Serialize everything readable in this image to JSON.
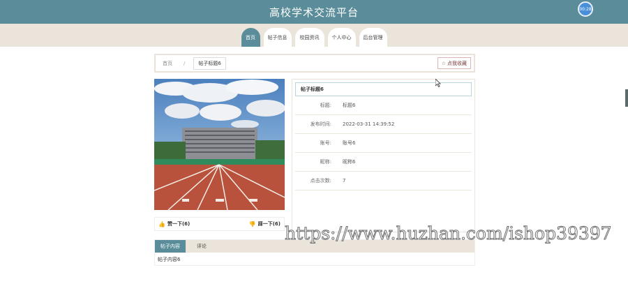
{
  "header": {
    "title": "高校学术交流平台",
    "clock": "00:28"
  },
  "nav": {
    "items": [
      "首页",
      "帖子信息",
      "校园资讯",
      "个人中心",
      "后台管理"
    ],
    "active_index": 0
  },
  "breadcrumb": {
    "home": "首页",
    "separator": "/",
    "current": "帖子标题6"
  },
  "favorite_button": {
    "label": "点我收藏",
    "icon": "star-icon"
  },
  "post": {
    "title": "帖子标题6",
    "fields": [
      {
        "label": "标题:",
        "value": "标题6"
      },
      {
        "label": "发布时间:",
        "value": "2022-03-31 14:39:52"
      },
      {
        "label": "账号:",
        "value": "账号6"
      },
      {
        "label": "昵称:",
        "value": "昵称6"
      },
      {
        "label": "点击次数:",
        "value": "7"
      }
    ]
  },
  "reactions": {
    "like": "赞一下(6)",
    "dislike": "踩一下(6)",
    "icons": [
      "thumbs-up-icon",
      "thumbs-down-icon"
    ]
  },
  "tabs": {
    "items": [
      "帖子内容",
      "评论"
    ],
    "active_index": 0,
    "content": "帖子内容6"
  },
  "watermark": "https://www.huzhan.com/ishop39397",
  "colors": {
    "primary": "#5a8c9a",
    "beige": "#ebe4da",
    "accent_red": "#d0363b"
  }
}
